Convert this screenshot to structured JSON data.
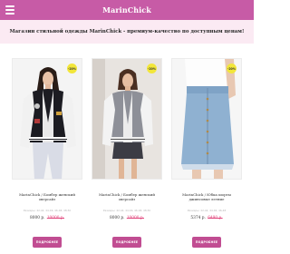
{
  "header": {
    "logo": "MarinChick"
  },
  "tagline": "Магазин стильной одежды MarinChick - премиум-качество по доступным ценам!",
  "products": [
    {
      "badge": "-20%",
      "title": "MarinChick / Бомбер женский оверсайз",
      "sizes": "Размеры: 42-44, 44-46, 46-48, 48-50",
      "price": "8000 р.",
      "old_price": "10000 р.",
      "button": "ПОДРОБНЕЕ"
    },
    {
      "badge": "-20%",
      "title": "MarinChick / Бомбер женский оверсайз",
      "sizes": "Размеры: 42-44, 44-46, 46-48, 48-50",
      "price": "8000 р.",
      "old_price": "10000 р.",
      "button": "ПОДРОБНЕЕ"
    },
    {
      "badge": "-20%",
      "title": "MarinChick / Юбка шорты джинсовые летние",
      "sizes": "Размеры: 42-44, 44-46, 46-48",
      "price": "5374 р.",
      "old_price": "6490 р.",
      "button": "ПОДРОБНЕЕ"
    }
  ]
}
